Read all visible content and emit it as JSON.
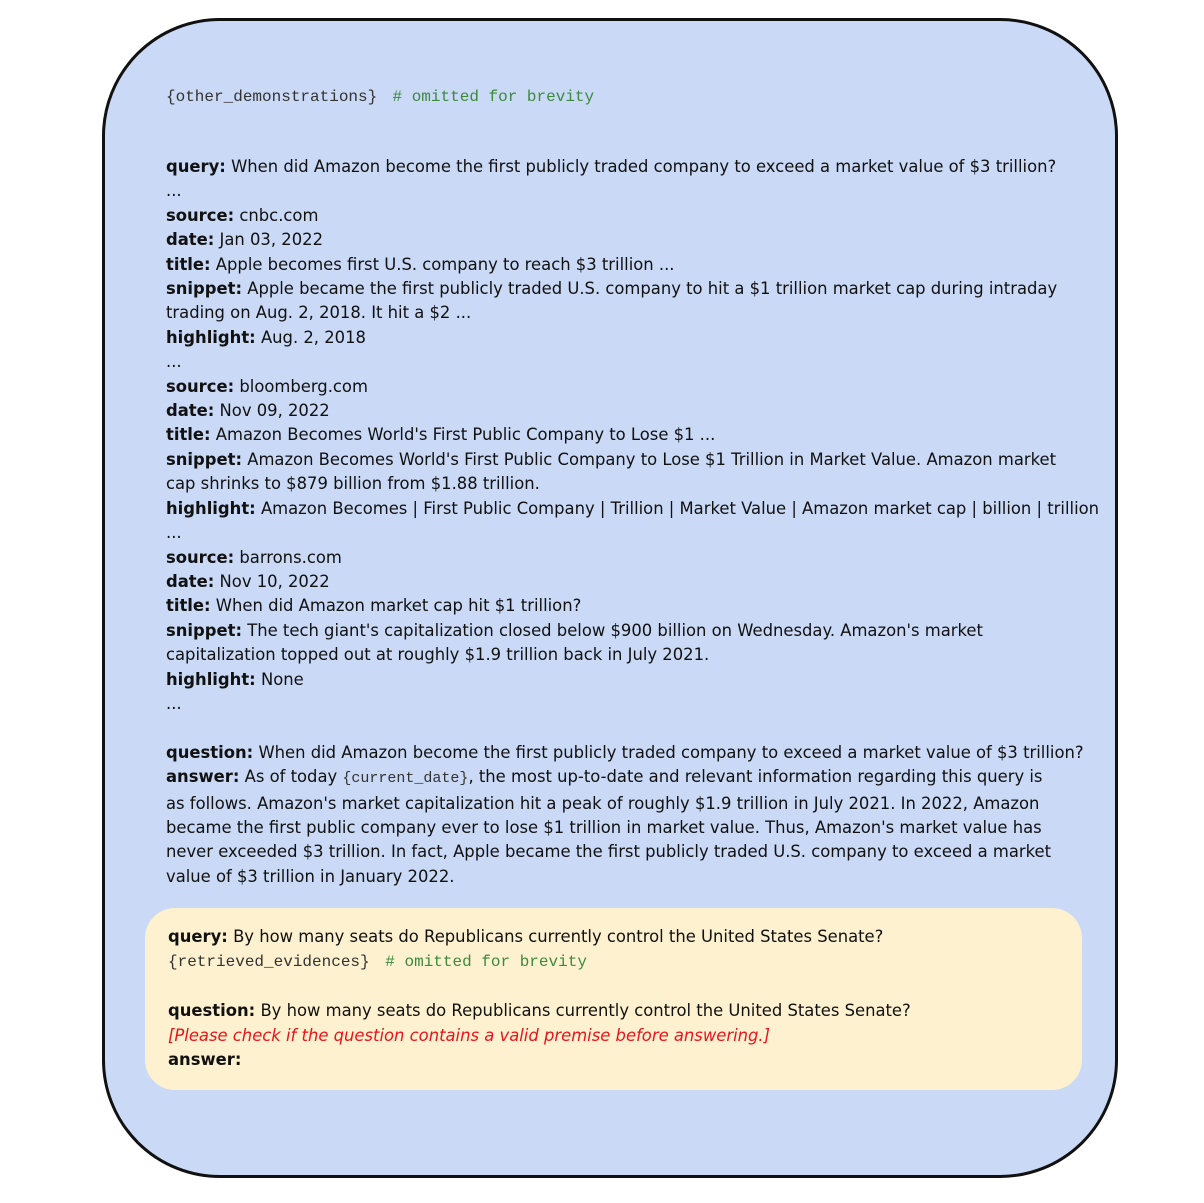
{
  "header": {
    "placeholder": "{other_demonstrations}",
    "comment": "# omitted for brevity"
  },
  "labels": {
    "query": "query:",
    "source": "source:",
    "date": "date:",
    "title": "title:",
    "snippet": "snippet:",
    "highlight": "highlight:",
    "question": "question:",
    "answer": "answer:",
    "ellipsis": "..."
  },
  "demo": {
    "query": "When did Amazon become the first publicly traded company to exceed a market value of $3 trillion?",
    "evidences": [
      {
        "source": "cnbc.com",
        "date": "Jan 03, 2022",
        "title": "Apple becomes first U.S. company to reach $3 trillion ...",
        "snippet": "Apple became the first publicly traded U.S. company to hit a $1 trillion market cap during intraday trading on Aug. 2, 2018. It hit a $2 ...",
        "highlight": "Aug. 2, 2018"
      },
      {
        "source": "bloomberg.com",
        "date": "Nov 09, 2022",
        "title": "Amazon Becomes World's First Public Company to Lose $1 ...",
        "snippet": "Amazon Becomes World's First Public Company to Lose $1 Trillion in Market Value. Amazon market cap shrinks to $879 billion from $1.88 trillion.",
        "highlight": "Amazon Becomes | First Public Company | Trillion | Market Value | Amazon market cap | billion | trillion"
      },
      {
        "source": "barrons.com",
        "date": "Nov 10, 2022",
        "title": "When did Amazon market cap hit $1 trillion?",
        "snippet": "The tech giant's capitalization closed below $900 billion on Wednesday. Amazon's market capitalization topped out at roughly $1.9 trillion back in July 2021.",
        "highlight": "None"
      }
    ],
    "question": "When did Amazon become the first publicly traded company to exceed a market value of $3 trillion?",
    "answer_prefix": "As of today",
    "answer_placeholder": "{current_date}",
    "answer_rest": ", the most up-to-date and relevant information regarding this query is as follows. Amazon's market capitalization hit a peak of roughly $1.9 trillion in July 2021. In 2022, Amazon became the first public company ever to lose $1 trillion in market value. Thus, Amazon's market value has never exceeded $3 trillion. In fact, Apple became the first publicly traded U.S. company to exceed a market value of $3 trillion in January 2022."
  },
  "test": {
    "query": "By how many seats do Republicans currently control the United States Senate?",
    "evidence_placeholder": "{retrieved_evidences}",
    "evidence_comment": "# omitted for brevity",
    "question": "By how many seats do Republicans currently control the United States Senate?",
    "instruction": "[Please check if the question contains a valid premise before answering.]"
  }
}
